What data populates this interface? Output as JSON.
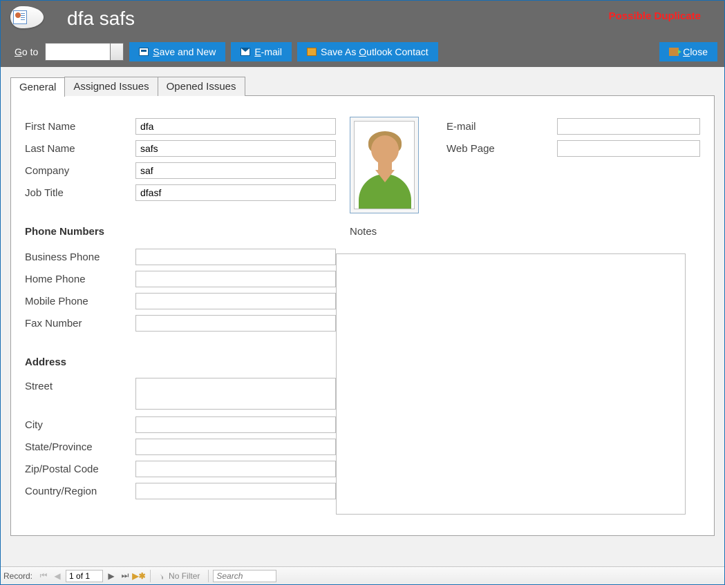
{
  "header": {
    "title": "dfa safs",
    "duplicate_warning": "Possible Duplicate"
  },
  "toolbar": {
    "goto_label_pre": "G",
    "goto_label_post": "o to",
    "goto_value": "",
    "save_new_pre": "S",
    "save_new_post": "ave and New",
    "email_pre": "E",
    "email_post": "-mail",
    "outlook_pre": "Save As ",
    "outlook_u": "O",
    "outlook_post": "utlook Contact",
    "close_pre": "C",
    "close_post": "lose"
  },
  "tabs": {
    "general": "General",
    "assigned": "Assigned Issues",
    "opened": "Opened Issues"
  },
  "fields": {
    "first_name_label": "First Name",
    "first_name": "dfa",
    "last_name_label": "Last Name",
    "last_name": "safs",
    "company_label": "Company",
    "company": "saf",
    "job_title_label": "Job Title",
    "job_title": "dfasf",
    "email_label": "E-mail",
    "email": "",
    "webpage_label": "Web Page",
    "webpage": "",
    "phone_section": "Phone Numbers",
    "business_phone_label": "Business Phone",
    "business_phone": "",
    "home_phone_label": "Home Phone",
    "home_phone": "",
    "mobile_phone_label": "Mobile Phone",
    "mobile_phone": "",
    "fax_label": "Fax Number",
    "fax": "",
    "address_section": "Address",
    "street_label": "Street",
    "street": "",
    "city_label": "City",
    "city": "",
    "state_label": "State/Province",
    "state": "",
    "zip_label": "Zip/Postal Code",
    "zip": "",
    "country_label": "Country/Region",
    "country": "",
    "notes_label": "Notes",
    "notes": ""
  },
  "status": {
    "record_label": "Record:",
    "record_value": "1 of 1",
    "no_filter": "No Filter",
    "search_placeholder": "Search"
  }
}
